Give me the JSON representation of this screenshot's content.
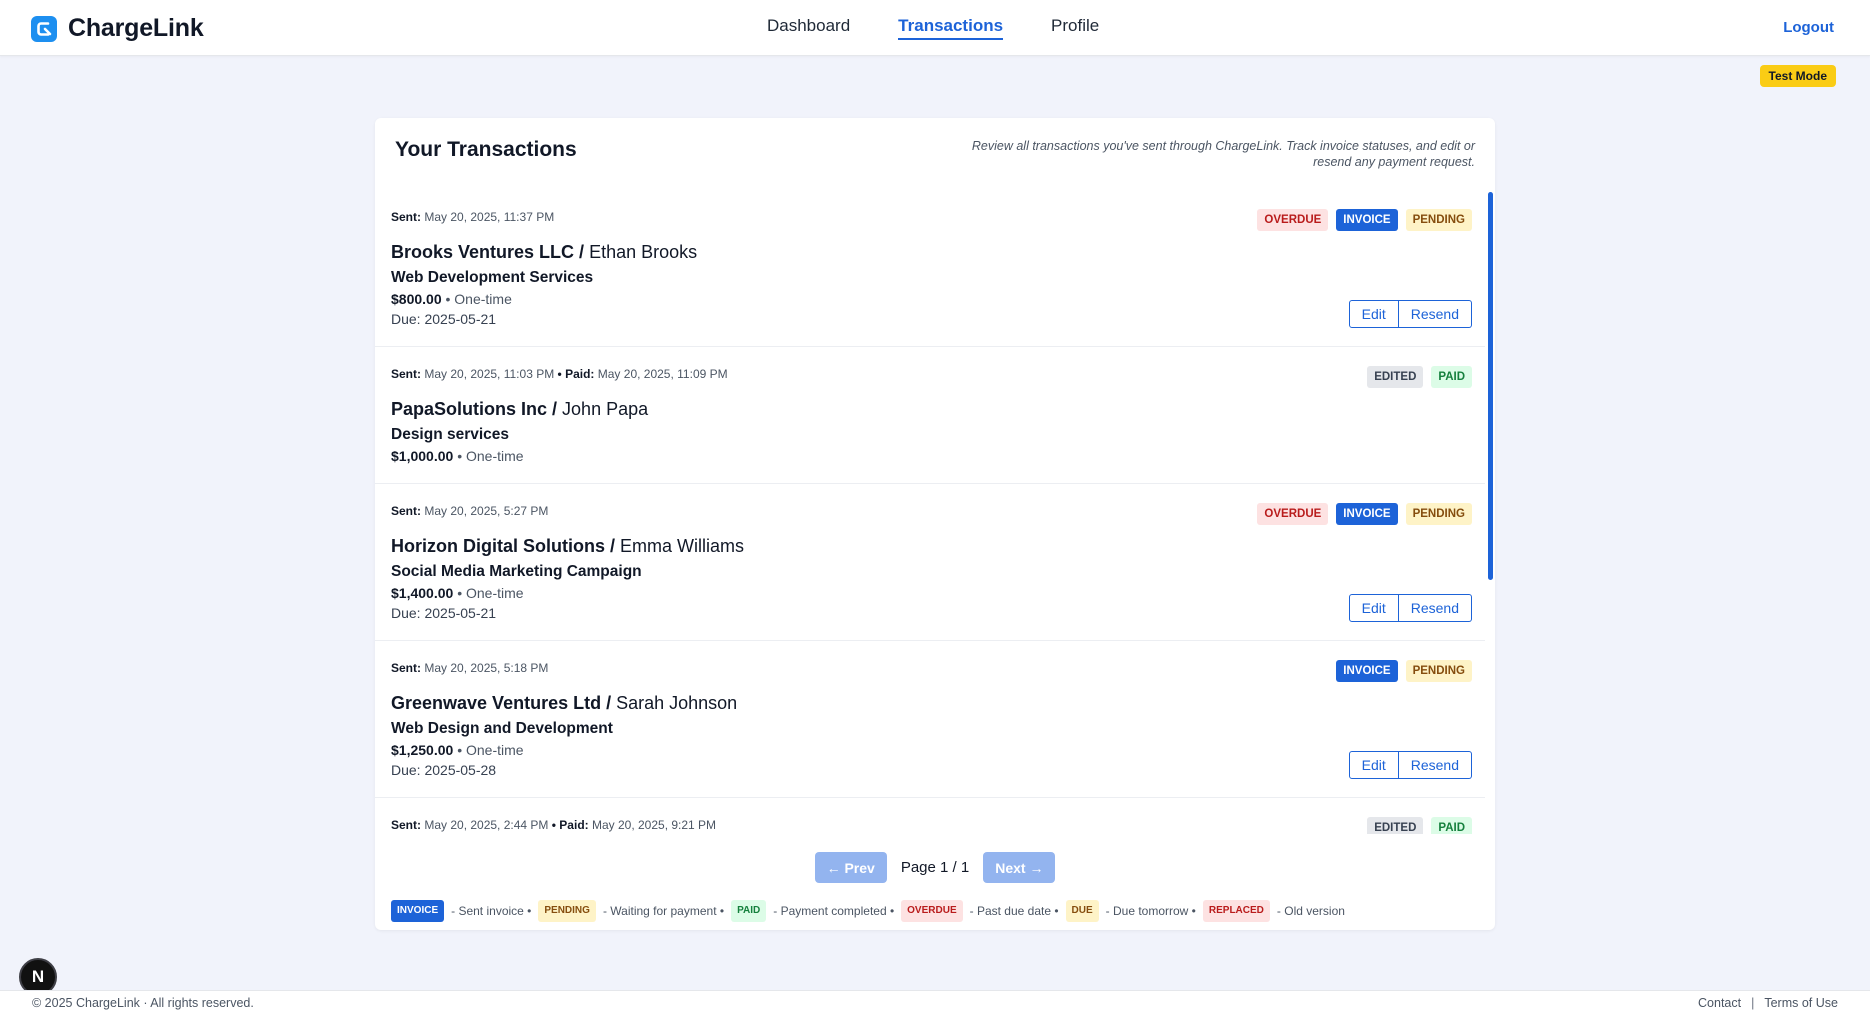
{
  "header": {
    "brand": "ChargeLink",
    "nav": [
      {
        "label": "Dashboard",
        "active": false
      },
      {
        "label": "Transactions",
        "active": true
      },
      {
        "label": "Profile",
        "active": false
      }
    ],
    "logout": "Logout"
  },
  "test_mode": "Test Mode",
  "page": {
    "title": "Your Transactions",
    "description": "Review all transactions you've sent through ChargeLink. Track invoice statuses, and edit or resend any payment request."
  },
  "transactions": [
    {
      "sent_label": "Sent:",
      "sent": "May 20, 2025, 11:37 PM",
      "company": "Brooks Ventures LLC /",
      "contact": "Ethan Brooks",
      "service": "Web Development Services",
      "amount": "$800.00",
      "frequency": "• One-time",
      "due": "Due: 2025-05-21",
      "badges": [
        "OVERDUE",
        "INVOICE",
        "PENDING"
      ],
      "edit": "Edit",
      "resend": "Resend"
    },
    {
      "sent_label": "Sent:",
      "sent": "May 20, 2025, 11:03 PM",
      "paid_label": "• Paid:",
      "paid": "May 20, 2025, 11:09 PM",
      "company": "PapaSolutions Inc /",
      "contact": "John Papa",
      "service": "Design services",
      "amount": "$1,000.00",
      "frequency": "• One-time",
      "badges": [
        "EDITED",
        "PAID"
      ]
    },
    {
      "sent_label": "Sent:",
      "sent": "May 20, 2025, 5:27 PM",
      "company": "Horizon Digital Solutions /",
      "contact": "Emma Williams",
      "service": "Social Media Marketing Campaign",
      "amount": "$1,400.00",
      "frequency": "• One-time",
      "due": "Due: 2025-05-21",
      "badges": [
        "OVERDUE",
        "INVOICE",
        "PENDING"
      ],
      "edit": "Edit",
      "resend": "Resend"
    },
    {
      "sent_label": "Sent:",
      "sent": "May 20, 2025, 5:18 PM",
      "company": "Greenwave Ventures Ltd /",
      "contact": "Sarah Johnson",
      "service": "Web Design and Development",
      "amount": "$1,250.00",
      "frequency": "• One-time",
      "due": "Due: 2025-05-28",
      "badges": [
        "INVOICE",
        "PENDING"
      ],
      "edit": "Edit",
      "resend": "Resend"
    },
    {
      "sent_label": "Sent:",
      "sent": "May 20, 2025, 2:44 PM",
      "paid_label": "• Paid:",
      "paid": "May 20, 2025, 9:21 PM",
      "badges": [
        "EDITED",
        "PAID"
      ]
    }
  ],
  "pagination": {
    "prev": "← Prev",
    "page": "Page 1 / 1",
    "next": "Next →"
  },
  "legend": [
    {
      "badge": "INVOICE",
      "text": "- Sent invoice •"
    },
    {
      "badge": "PENDING",
      "text": "- Waiting for payment •"
    },
    {
      "badge": "PAID",
      "text": "- Payment completed •"
    },
    {
      "badge": "OVERDUE",
      "text": "- Past due date •"
    },
    {
      "badge": "DUE",
      "text": "- Due tomorrow •"
    },
    {
      "badge": "REPLACED",
      "text": "- Old version"
    }
  ],
  "footer": {
    "copyright": "© 2025 ChargeLink  ·  All rights reserved.",
    "contact": "Contact",
    "divider": "|",
    "terms": "Terms of Use"
  },
  "dev_badge": "N",
  "colors": {
    "accent": "#1d63d8",
    "test_mode": "#facc15",
    "background": "#f1f3fb"
  }
}
